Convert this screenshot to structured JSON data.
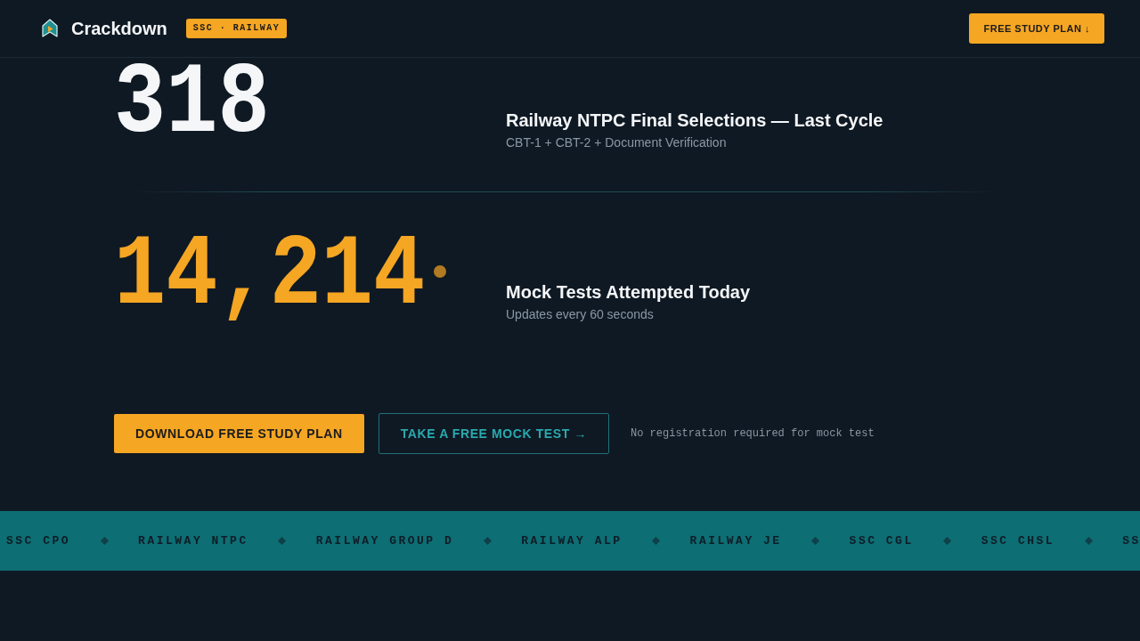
{
  "header": {
    "brand": "Crackdown",
    "badge": "SSC · RAILWAY",
    "cta": "FREE STUDY PLAN ↓"
  },
  "stats": [
    {
      "value": "318",
      "color": "#f4f6f8",
      "live": false,
      "title": "Railway NTPC Final Selections — Last Cycle",
      "subtitle": "CBT-1 + CBT-2 + Document Verification"
    },
    {
      "value": "14,214",
      "color": "#f5a623",
      "live": true,
      "title": "Mock Tests Attempted Today",
      "subtitle": "Updates every 60 seconds"
    }
  ],
  "actions": {
    "buttons": [
      {
        "label": "DOWNLOAD FREE STUDY PLAN",
        "kind": "primary"
      },
      {
        "label": "TAKE A FREE MOCK TEST →",
        "kind": "outline"
      }
    ],
    "note": "No registration required for mock test"
  },
  "ticker": [
    "SSC CPO",
    "RAILWAY NTPC",
    "RAILWAY GROUP D",
    "RAILWAY ALP",
    "RAILWAY JE",
    "SSC CGL",
    "SSC CHSL",
    "SS"
  ]
}
